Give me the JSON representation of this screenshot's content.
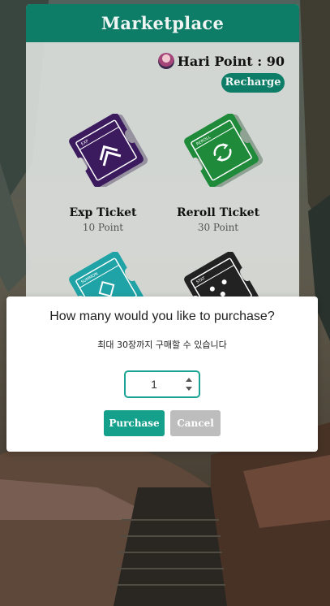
{
  "marketplace": {
    "title": "Marketplace",
    "points_label": "Hari Point : 90",
    "recharge_label": "Recharge",
    "tickets": [
      {
        "name": "Exp Ticket",
        "price": "10 Point",
        "tag": "EXP",
        "color": "#3b1a5e"
      },
      {
        "name": "Reroll Ticket",
        "price": "30 Point",
        "tag": "REROLL",
        "color": "#1e8a3a"
      },
      {
        "name": "",
        "price": "",
        "tag": "SUMMON",
        "color": "#1fa3a6"
      },
      {
        "name": "",
        "price": "",
        "tag": "STAT",
        "color": "#222222"
      }
    ]
  },
  "dialog": {
    "title": "How many would you like to purchase?",
    "subtitle": "최대 30장까지 구매할 수 있습니다",
    "quantity": "1",
    "purchase_label": "Purchase",
    "cancel_label": "Cancel"
  },
  "colors": {
    "header": "#0d7d68",
    "accent": "#14a08a",
    "cancel": "#bdbdbd"
  }
}
